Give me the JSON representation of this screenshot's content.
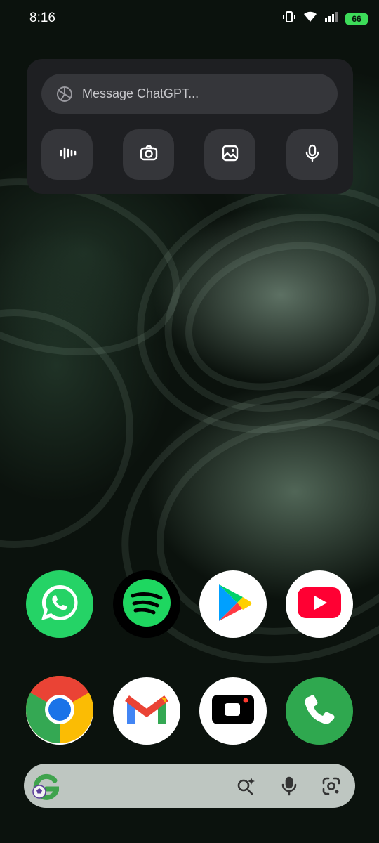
{
  "status_bar": {
    "time": "8:16",
    "battery": "66",
    "icons": [
      "vibrate-icon",
      "wifi-icon",
      "cell-signal-icon",
      "battery-icon"
    ]
  },
  "chatgpt_widget": {
    "search_placeholder": "Message ChatGPT...",
    "buttons": [
      "voice-waveform-icon",
      "camera-icon",
      "image-icon",
      "microphone-icon"
    ]
  },
  "dock_row_1": [
    "WhatsApp",
    "Spotify",
    "Google Play",
    "YouTube"
  ],
  "dock_row_2": [
    "Chrome",
    "Gmail",
    "Camera",
    "Phone"
  ],
  "google_bar": {
    "icons": [
      "google-doodle-icon",
      "search-spark-icon",
      "microphone-icon",
      "lens-icon"
    ]
  },
  "colors": {
    "widget_bg": "#1e1f22",
    "battery": "#3ddc59",
    "whatsapp": "#25d366",
    "spotify": "#1ed760",
    "youtube": "#ff0033",
    "phone": "#2fa84f"
  }
}
